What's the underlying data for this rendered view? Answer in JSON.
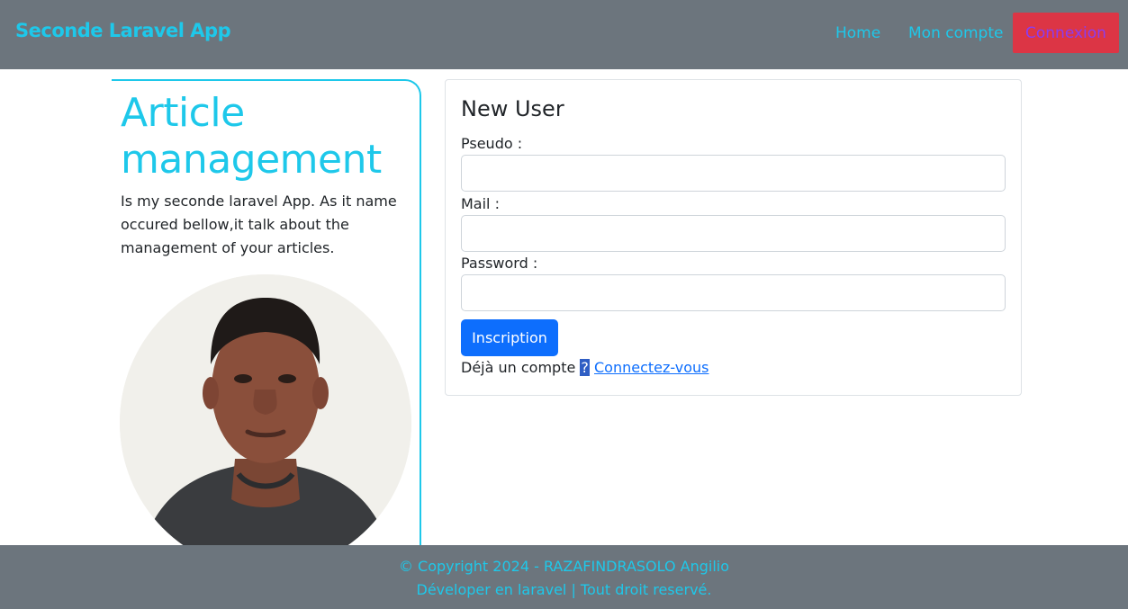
{
  "header": {
    "brand": "Seconde Laravel App",
    "nav": {
      "home": "Home",
      "account": "Mon compte",
      "login": "Connexion"
    }
  },
  "sidebar": {
    "title": "Article management",
    "description": "Is my seconde laravel App. As it name occured bellow,it talk about the management of your articles."
  },
  "form": {
    "title": "New User",
    "fields": {
      "pseudo_label": "Pseudo :",
      "pseudo_value": "",
      "mail_label": "Mail :",
      "mail_value": "",
      "password_label": "Password :",
      "password_value": ""
    },
    "submit": "Inscription",
    "already_text": "Déjà un compte ",
    "question_mark": "?",
    "login_link": "Connectez-vous"
  },
  "footer": {
    "line1": "© Copyright 2024 - RAZAFINDRASOLO Angilio",
    "line2": "Déveloper en laravel | Tout droit reservé."
  },
  "colors": {
    "navbar_bg": "#6c757d",
    "accent_cyan": "#1ec8ea",
    "login_bg": "#dc3545",
    "primary": "#0d6efd"
  }
}
